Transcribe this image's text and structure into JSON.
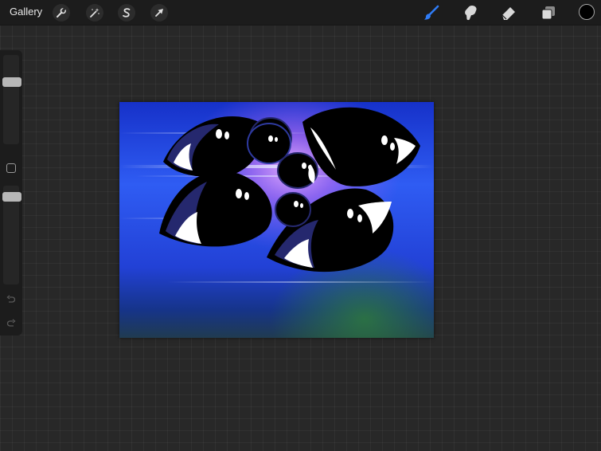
{
  "app": {
    "gallery_label": "Gallery",
    "left_tools": [
      "actions-wrench-icon",
      "adjustments-wand-icon",
      "selection-s-icon",
      "transform-arrow-icon"
    ],
    "right_tools": [
      "brush-icon",
      "smudge-icon",
      "eraser-icon",
      "layers-icon"
    ],
    "active_tool": "brush-icon",
    "current_color": "#000000",
    "accent_color": "#2f7cf6"
  },
  "sidebar": {
    "brush_size_level": 0.72,
    "brush_opacity_level": 0.93,
    "controls": [
      "modify-button",
      "undo-icon",
      "redo-icon"
    ]
  },
  "canvas": {
    "background_colors": [
      "#1631c9",
      "#2f5cf3",
      "#c86cf0",
      "#16348a",
      "#203b50"
    ],
    "eye_colors": {
      "outline": "#000000",
      "iris": "#25286e",
      "sclera": "#ffffff",
      "pupil": "#000000"
    }
  }
}
